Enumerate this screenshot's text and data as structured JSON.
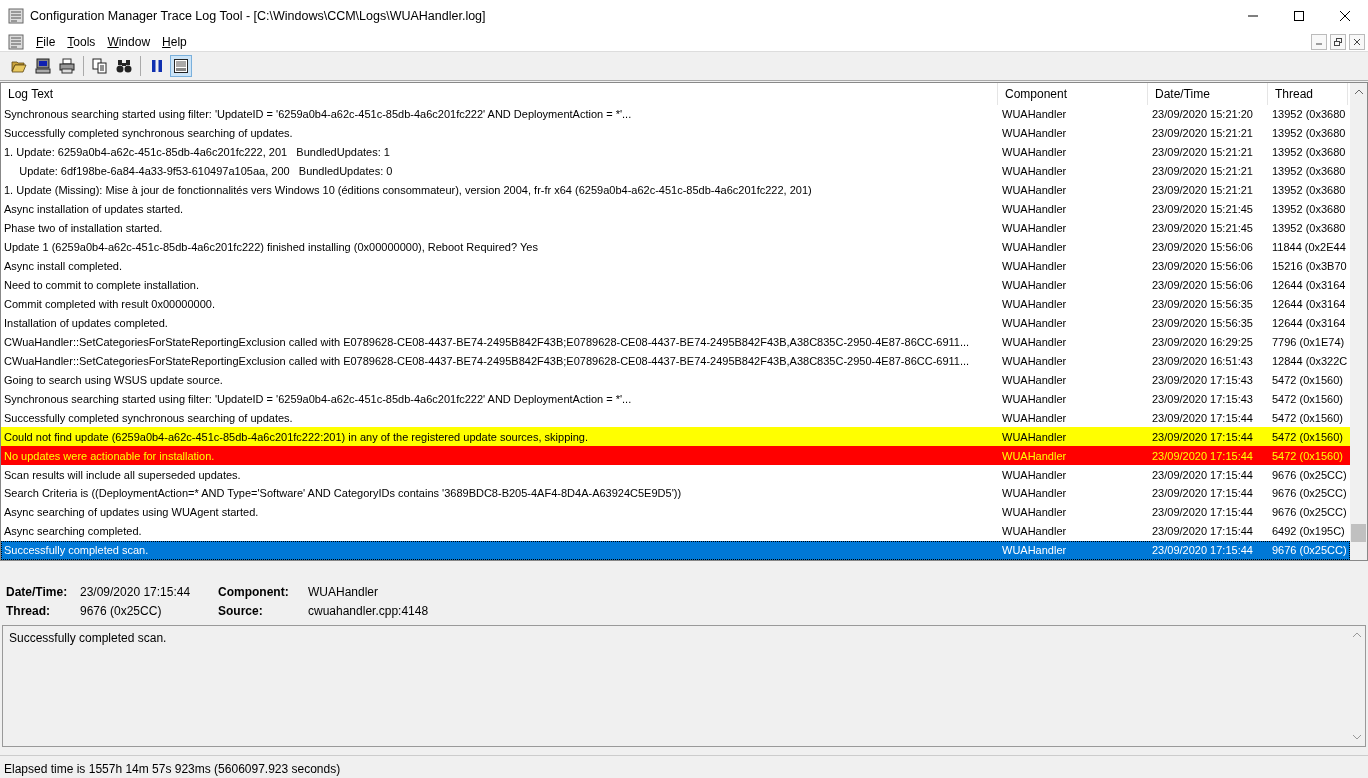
{
  "window": {
    "title": "Configuration Manager Trace Log Tool - [C:\\Windows\\CCM\\Logs\\WUAHandler.log]"
  },
  "menu": [
    {
      "label": "File"
    },
    {
      "label": "Tools"
    },
    {
      "label": "Window"
    },
    {
      "label": "Help"
    }
  ],
  "toolbar": [
    {
      "kind": "open",
      "pressed": false
    },
    {
      "kind": "computer",
      "pressed": false
    },
    {
      "kind": "print",
      "pressed": false
    },
    {
      "kind": "separator"
    },
    {
      "kind": "copy",
      "pressed": false
    },
    {
      "kind": "find",
      "pressed": false
    },
    {
      "kind": "separator"
    },
    {
      "kind": "pause",
      "pressed": false
    },
    {
      "kind": "details",
      "pressed": true
    }
  ],
  "table": {
    "columns": [
      "Log Text",
      "Component",
      "Date/Time",
      "Thread"
    ],
    "rows": [
      {
        "text": "Synchronous searching started using filter: 'UpdateID = '6259a0b4-a62c-451c-85db-4a6c201fc222' AND DeploymentAction = *'...",
        "component": "WUAHandler",
        "datetime": "23/09/2020 15:21:20",
        "thread": "13952 (0x3680",
        "kind": "info",
        "selected": false
      },
      {
        "text": "Successfully completed synchronous searching of updates.",
        "component": "WUAHandler",
        "datetime": "23/09/2020 15:21:21",
        "thread": "13952 (0x3680",
        "kind": "info",
        "selected": false
      },
      {
        "text": "1. Update: 6259a0b4-a62c-451c-85db-4a6c201fc222, 201   BundledUpdates: 1",
        "component": "WUAHandler",
        "datetime": "23/09/2020 15:21:21",
        "thread": "13952 (0x3680",
        "kind": "info",
        "selected": false
      },
      {
        "text": "     Update: 6df198be-6a84-4a33-9f53-610497a105aa, 200   BundledUpdates: 0",
        "component": "WUAHandler",
        "datetime": "23/09/2020 15:21:21",
        "thread": "13952 (0x3680",
        "kind": "info",
        "selected": false
      },
      {
        "text": "1. Update (Missing): Mise à jour de fonctionnalités vers Windows 10 (éditions consommateur), version 2004, fr-fr x64 (6259a0b4-a62c-451c-85db-4a6c201fc222, 201)",
        "component": "WUAHandler",
        "datetime": "23/09/2020 15:21:21",
        "thread": "13952 (0x3680",
        "kind": "info",
        "selected": false
      },
      {
        "text": "Async installation of updates started.",
        "component": "WUAHandler",
        "datetime": "23/09/2020 15:21:45",
        "thread": "13952 (0x3680",
        "kind": "info",
        "selected": false
      },
      {
        "text": "Phase two of installation started.",
        "component": "WUAHandler",
        "datetime": "23/09/2020 15:21:45",
        "thread": "13952 (0x3680",
        "kind": "info",
        "selected": false
      },
      {
        "text": "Update 1 (6259a0b4-a62c-451c-85db-4a6c201fc222) finished installing (0x00000000), Reboot Required? Yes",
        "component": "WUAHandler",
        "datetime": "23/09/2020 15:56:06",
        "thread": "11844 (0x2E44",
        "kind": "info",
        "selected": false
      },
      {
        "text": "Async install completed.",
        "component": "WUAHandler",
        "datetime": "23/09/2020 15:56:06",
        "thread": "15216 (0x3B70",
        "kind": "info",
        "selected": false
      },
      {
        "text": "Need to commit to complete installation.",
        "component": "WUAHandler",
        "datetime": "23/09/2020 15:56:06",
        "thread": "12644 (0x3164",
        "kind": "info",
        "selected": false
      },
      {
        "text": "Commit completed with result 0x00000000.",
        "component": "WUAHandler",
        "datetime": "23/09/2020 15:56:35",
        "thread": "12644 (0x3164",
        "kind": "info",
        "selected": false
      },
      {
        "text": "Installation of updates completed.",
        "component": "WUAHandler",
        "datetime": "23/09/2020 15:56:35",
        "thread": "12644 (0x3164",
        "kind": "info",
        "selected": false
      },
      {
        "text": "CWuaHandler::SetCategoriesForStateReportingExclusion called with E0789628-CE08-4437-BE74-2495B842F43B;E0789628-CE08-4437-BE74-2495B842F43B,A38C835C-2950-4E87-86CC-6911...",
        "component": "WUAHandler",
        "datetime": "23/09/2020 16:29:25",
        "thread": "7796 (0x1E74)",
        "kind": "info",
        "selected": false
      },
      {
        "text": "CWuaHandler::SetCategoriesForStateReportingExclusion called with E0789628-CE08-4437-BE74-2495B842F43B;E0789628-CE08-4437-BE74-2495B842F43B,A38C835C-2950-4E87-86CC-6911...",
        "component": "WUAHandler",
        "datetime": "23/09/2020 16:51:43",
        "thread": "12844 (0x322C",
        "kind": "info",
        "selected": false
      },
      {
        "text": "Going to search using WSUS update source.",
        "component": "WUAHandler",
        "datetime": "23/09/2020 17:15:43",
        "thread": "5472 (0x1560)",
        "kind": "info",
        "selected": false
      },
      {
        "text": "Synchronous searching started using filter: 'UpdateID = '6259a0b4-a62c-451c-85db-4a6c201fc222' AND DeploymentAction = *'...",
        "component": "WUAHandler",
        "datetime": "23/09/2020 17:15:43",
        "thread": "5472 (0x1560)",
        "kind": "info",
        "selected": false
      },
      {
        "text": "Successfully completed synchronous searching of updates.",
        "component": "WUAHandler",
        "datetime": "23/09/2020 17:15:44",
        "thread": "5472 (0x1560)",
        "kind": "info",
        "selected": false
      },
      {
        "text": "Could not find update (6259a0b4-a62c-451c-85db-4a6c201fc222:201) in any of the registered update sources, skipping.",
        "component": "WUAHandler",
        "datetime": "23/09/2020 17:15:44",
        "thread": "5472 (0x1560)",
        "kind": "warning",
        "selected": false
      },
      {
        "text": "No updates were actionable for installation.",
        "component": "WUAHandler",
        "datetime": "23/09/2020 17:15:44",
        "thread": "5472 (0x1560)",
        "kind": "error",
        "selected": false
      },
      {
        "text": "Scan results will include all superseded updates.",
        "component": "WUAHandler",
        "datetime": "23/09/2020 17:15:44",
        "thread": "9676 (0x25CC)",
        "kind": "info",
        "selected": false
      },
      {
        "text": "Search Criteria is ((DeploymentAction=* AND Type='Software' AND CategoryIDs contains '3689BDC8-B205-4AF4-8D4A-A63924C5E9D5'))",
        "component": "WUAHandler",
        "datetime": "23/09/2020 17:15:44",
        "thread": "9676 (0x25CC)",
        "kind": "info",
        "selected": false
      },
      {
        "text": "Async searching of updates using WUAgent started.",
        "component": "WUAHandler",
        "datetime": "23/09/2020 17:15:44",
        "thread": "9676 (0x25CC)",
        "kind": "info",
        "selected": false
      },
      {
        "text": "Async searching completed.",
        "component": "WUAHandler",
        "datetime": "23/09/2020 17:15:44",
        "thread": "6492 (0x195C)",
        "kind": "info",
        "selected": false
      },
      {
        "text": "Successfully completed scan.",
        "component": "WUAHandler",
        "datetime": "23/09/2020 17:15:44",
        "thread": "9676 (0x25CC)",
        "kind": "info",
        "selected": true
      }
    ]
  },
  "details": {
    "fields": [
      {
        "label": "Date/Time:",
        "value": "23/09/2020 17:15:44"
      },
      {
        "label": "Component:",
        "value": "WUAHandler"
      },
      {
        "label": "Thread:",
        "value": "9676 (0x25CC)"
      },
      {
        "label": "Source:",
        "value": "cwuahandler.cpp:4148"
      }
    ],
    "message": "Successfully completed scan."
  },
  "status_bar": "Elapsed time is 1557h 14m 57s 923ms (5606097.923 seconds)"
}
